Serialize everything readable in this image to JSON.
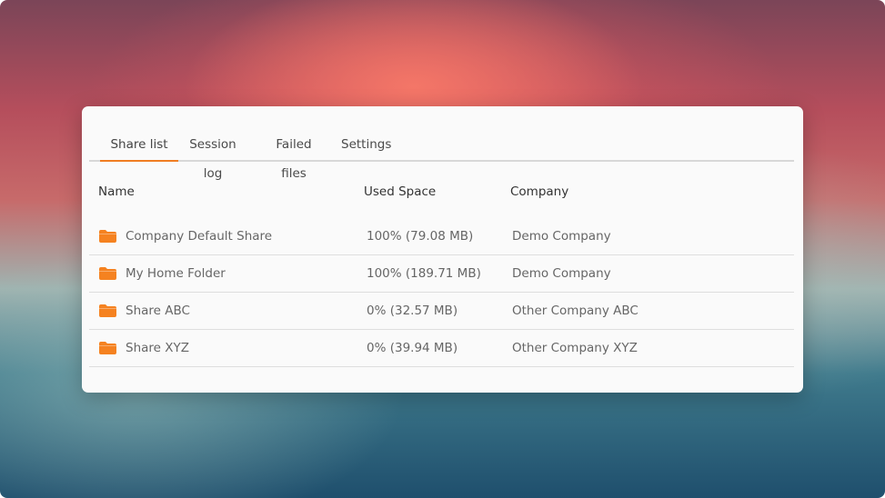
{
  "tabs": [
    {
      "label": "Share list",
      "active": true
    },
    {
      "label": "Session log",
      "active": false
    },
    {
      "label": "Failed files",
      "active": false
    },
    {
      "label": "Settings",
      "active": false
    }
  ],
  "table": {
    "columns": [
      "Name",
      "Used Space",
      "Company"
    ],
    "rows": [
      {
        "name": "Company Default Share",
        "used": "100% (79.08 MB)",
        "company": "Demo Company",
        "icon": "folder-icon"
      },
      {
        "name": "My Home Folder",
        "used": "100% (189.71 MB)",
        "company": "Demo Company",
        "icon": "folder-icon"
      },
      {
        "name": "Share ABC",
        "used": "0% (32.57 MB)",
        "company": "Other Company ABC",
        "icon": "folder-icon"
      },
      {
        "name": "Share XYZ",
        "used": "0% (39.94 MB)",
        "company": "Other Company XYZ",
        "icon": "folder-icon"
      }
    ]
  },
  "colors": {
    "accent": "#f07d22",
    "folder": "#f58220"
  }
}
